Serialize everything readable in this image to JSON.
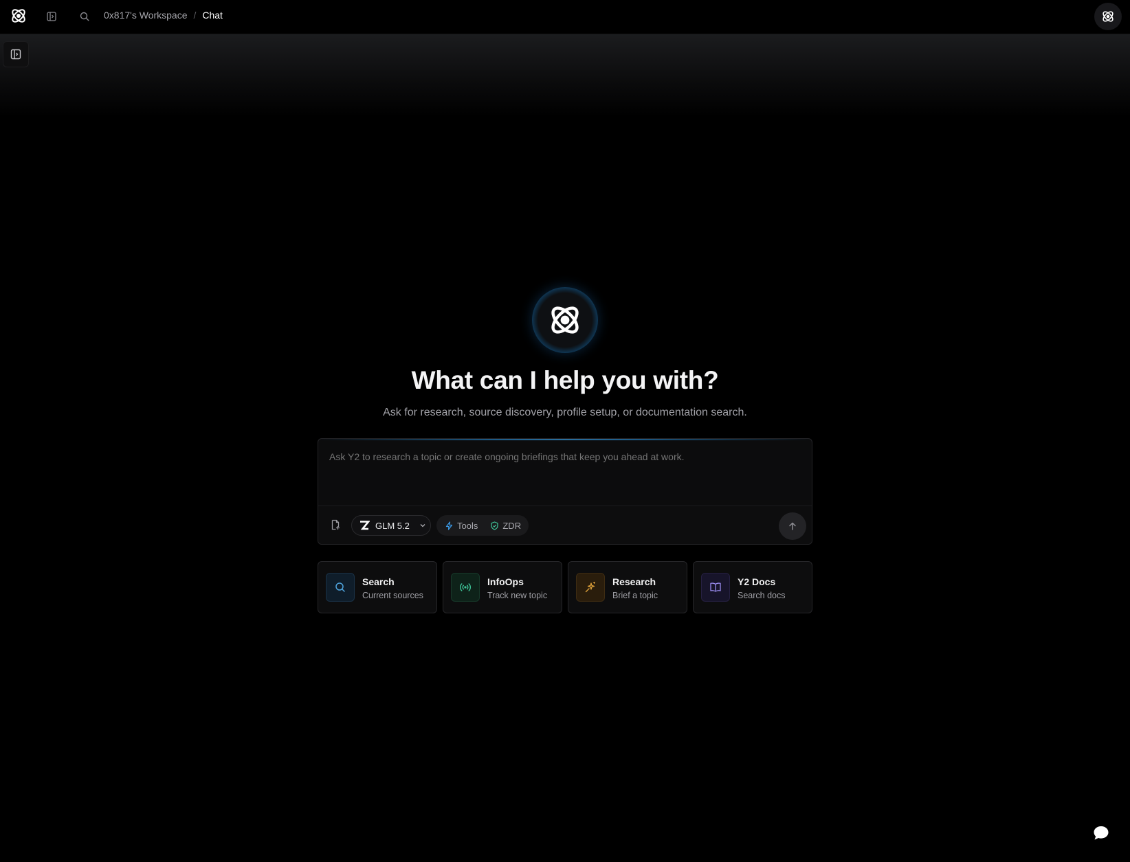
{
  "topbar": {
    "breadcrumb": {
      "workspace": "0x817's Workspace",
      "separator": "/",
      "current": "Chat"
    }
  },
  "hero": {
    "title": "What can I help you with?",
    "subtitle": "Ask for research, source discovery, profile setup, or documentation search."
  },
  "composer": {
    "placeholder": "Ask Y2 to research a topic or create ongoing briefings that keep you ahead at work.",
    "model": "GLM 5.2",
    "tools_label": "Tools",
    "zdr_label": "ZDR"
  },
  "cards": [
    {
      "title": "Search",
      "subtitle": "Current sources",
      "icon": "search-icon",
      "accent": "#4ea3dc"
    },
    {
      "title": "InfoOps",
      "subtitle": "Track new topic",
      "icon": "broadcast-icon",
      "accent": "#3fc79a"
    },
    {
      "title": "Research",
      "subtitle": "Brief a topic",
      "icon": "sparkles-icon",
      "accent": "#e0a23a"
    },
    {
      "title": "Y2 Docs",
      "subtitle": "Search docs",
      "icon": "book-icon",
      "accent": "#9b8cf0"
    }
  ],
  "colors": {
    "background": "#000000",
    "glow": "#1a6aa0",
    "tools_accent": "#3b9be8",
    "zdr_accent": "#3fc79a"
  }
}
